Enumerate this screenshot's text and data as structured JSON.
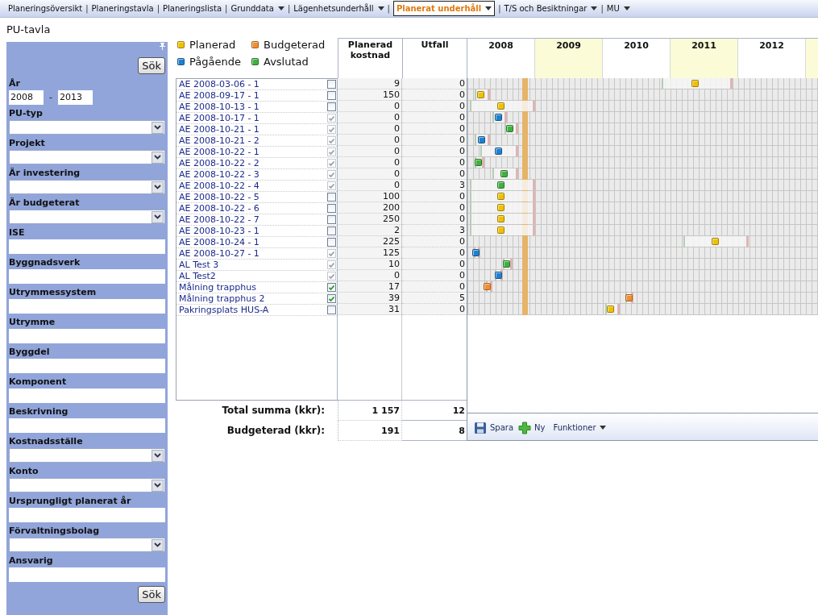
{
  "menu": [
    {
      "label": "Planeringsöversikt",
      "dropdown": false,
      "selected": false
    },
    {
      "separator": "|",
      "label": "Planeringstavla",
      "dropdown": false,
      "selected": false
    },
    {
      "separator": "|",
      "label": "Planeringslista",
      "dropdown": false,
      "selected": false
    },
    {
      "separator": "|",
      "label": "Grunddata",
      "dropdown": true,
      "selected": false
    },
    {
      "separator": "|",
      "label": "Lägenhetsunderhåll",
      "dropdown": true,
      "selected": false
    },
    {
      "separator": "|",
      "label": "Planerat underhåll",
      "dropdown": true,
      "selected": true
    },
    {
      "separator": "|",
      "label": "T/S och Besiktningar",
      "dropdown": true,
      "selected": false
    },
    {
      "separator": "|",
      "label": "MU",
      "dropdown": true,
      "selected": false
    }
  ],
  "page_title": "PU-tavla",
  "filter": {
    "search_button": "Sök",
    "bottom_button": "Sök",
    "fields": [
      {
        "label": "År",
        "kind": "range",
        "from": "2008",
        "separator": "-",
        "to": "2013"
      },
      {
        "label": "PU-typ",
        "kind": "select"
      },
      {
        "label": "Projekt",
        "kind": "select"
      },
      {
        "label": "Är investering",
        "kind": "select"
      },
      {
        "label": "Är budgeterat",
        "kind": "select"
      },
      {
        "label": "ISE",
        "kind": "text"
      },
      {
        "label": "Byggnadsverk",
        "kind": "text"
      },
      {
        "label": "Utrymmessystem",
        "kind": "text"
      },
      {
        "label": "Utrymme",
        "kind": "text"
      },
      {
        "label": "Byggdel",
        "kind": "text"
      },
      {
        "label": "Komponent",
        "kind": "text"
      },
      {
        "label": "Beskrivning",
        "kind": "text"
      },
      {
        "label": "Kostnadsställe",
        "kind": "select"
      },
      {
        "label": "Konto",
        "kind": "select"
      },
      {
        "label": "Ursprungligt planerat år",
        "kind": "text"
      },
      {
        "label": "Förvaltningsbolag",
        "kind": "select"
      },
      {
        "label": "Ansvarig",
        "kind": "text"
      }
    ]
  },
  "legend": [
    {
      "label": "Planerad",
      "color": "#f0c000"
    },
    {
      "label": "Budgeterad",
      "color": "#f09030"
    },
    {
      "label": "Pågående",
      "color": "#2080d0"
    },
    {
      "label": "Avslutad",
      "color": "#40b040"
    }
  ],
  "columns": [
    "Planerad kostnad",
    "Utfall"
  ],
  "years": [
    {
      "label": "2008",
      "shaded": false
    },
    {
      "label": "2009",
      "shaded": true
    },
    {
      "label": "2010",
      "shaded": false
    },
    {
      "label": "2011",
      "shaded": true
    },
    {
      "label": "2012",
      "shaded": false
    }
  ],
  "rows": [
    {
      "name": "AE 2008-03-06 - 1",
      "checked": false,
      "disabled": false,
      "planned": "9",
      "outcome": "0",
      "color": "#f0c000"
    },
    {
      "name": "AE 2008-09-17 - 1",
      "checked": false,
      "disabled": false,
      "planned": "150",
      "outcome": "0",
      "color": "#f0c000"
    },
    {
      "name": "AE 2008-10-13 - 1",
      "checked": false,
      "disabled": false,
      "planned": "0",
      "outcome": "0",
      "color": "#f0c000"
    },
    {
      "name": "AE 2008-10-17 - 1",
      "checked": true,
      "disabled": true,
      "planned": "0",
      "outcome": "0",
      "color": "#2080d0"
    },
    {
      "name": "AE 2008-10-21 - 1",
      "checked": true,
      "disabled": true,
      "planned": "0",
      "outcome": "0",
      "color": "#40b040"
    },
    {
      "name": "AE 2008-10-21 - 2",
      "checked": true,
      "disabled": true,
      "planned": "0",
      "outcome": "0",
      "color": "#2080d0"
    },
    {
      "name": "AE 2008-10-22 - 1",
      "checked": true,
      "disabled": true,
      "planned": "0",
      "outcome": "0",
      "color": "#2080d0"
    },
    {
      "name": "AE 2008-10-22 - 2",
      "checked": true,
      "disabled": true,
      "planned": "0",
      "outcome": "0",
      "color": "#40b040"
    },
    {
      "name": "AE 2008-10-22 - 3",
      "checked": true,
      "disabled": true,
      "planned": "0",
      "outcome": "0",
      "color": "#40b040"
    },
    {
      "name": "AE 2008-10-22 - 4",
      "checked": true,
      "disabled": true,
      "planned": "0",
      "outcome": "3",
      "color": "#40b040"
    },
    {
      "name": "AE 2008-10-22 - 5",
      "checked": false,
      "disabled": false,
      "planned": "100",
      "outcome": "0",
      "color": "#f0c000"
    },
    {
      "name": "AE 2008-10-22 - 6",
      "checked": false,
      "disabled": false,
      "planned": "200",
      "outcome": "0",
      "color": "#f0c000"
    },
    {
      "name": "AE 2008-10-22 - 7",
      "checked": false,
      "disabled": false,
      "planned": "250",
      "outcome": "0",
      "color": "#f0c000"
    },
    {
      "name": "AE 2008-10-23 - 1",
      "checked": false,
      "disabled": false,
      "planned": "2",
      "outcome": "3",
      "color": "#f0c000"
    },
    {
      "name": "AE 2008-10-24 - 1",
      "checked": false,
      "disabled": false,
      "planned": "225",
      "outcome": "0",
      "color": "#f0c000"
    },
    {
      "name": "AE 2008-10-27 - 1",
      "checked": true,
      "disabled": true,
      "planned": "125",
      "outcome": "0",
      "color": "#2080d0"
    },
    {
      "name": "AL Test 3",
      "checked": true,
      "disabled": true,
      "planned": "10",
      "outcome": "0",
      "color": "#40b040"
    },
    {
      "name": "AL Test2",
      "checked": true,
      "disabled": true,
      "planned": "0",
      "outcome": "0",
      "color": "#2080d0"
    },
    {
      "name": "Målning trapphus",
      "checked": true,
      "disabled": false,
      "planned": "17",
      "outcome": "0",
      "color": "#f09030"
    },
    {
      "name": "Målning trapphus 2",
      "checked": true,
      "disabled": false,
      "planned": "39",
      "outcome": "5",
      "color": "#f09030"
    },
    {
      "name": "Pakringsplats HUS-A",
      "checked": false,
      "disabled": false,
      "planned": "31",
      "outcome": "0",
      "color": "#f0c000"
    }
  ],
  "totals": [
    {
      "label": "Total summa (kkr):",
      "planned": "1 157",
      "outcome": "12"
    },
    {
      "label": "Budgeterad (kkr):",
      "planned": "191",
      "outcome": "8"
    }
  ],
  "toolbar": [
    {
      "label": "Spara",
      "kind": "save"
    },
    {
      "label": "Ny",
      "kind": "new"
    },
    {
      "label": "Funktioner",
      "kind": "menu"
    }
  ]
}
